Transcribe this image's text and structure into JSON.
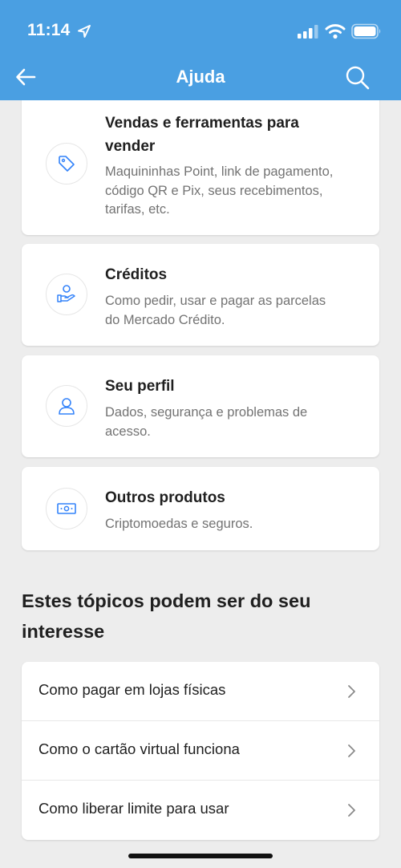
{
  "status_bar": {
    "time": "11:14"
  },
  "header": {
    "title": "Ajuda",
    "color": "#4a9fe2"
  },
  "cards": [
    {
      "title_line1": "Vendas e ferramentas para",
      "title_line2": "vender",
      "desc_line1": "Maquininhas Point, link de pagamento,",
      "desc_line2": "código QR e Pix, seus recebimentos,",
      "desc_line3": "tarifas, etc.",
      "icon": "tag-icon"
    },
    {
      "title": "Créditos",
      "desc_line1": "Como pedir, usar e pagar as parcelas",
      "desc_line2": "do Mercado Crédito.",
      "icon": "hand-coin-icon"
    },
    {
      "title": "Seu perfil",
      "desc_line1": "Dados, segurança e problemas de",
      "desc_line2": "acesso.",
      "icon": "user-icon"
    },
    {
      "title": "Outros produtos",
      "desc_line1": "Criptomoedas e seguros.",
      "icon": "banknote-icon"
    }
  ],
  "topics": {
    "heading_line1": "Estes tópicos podem ser do seu",
    "heading_line2": "interesse",
    "items": [
      {
        "label": "Como pagar em lojas físicas"
      },
      {
        "label": "Como o cartão virtual funciona"
      },
      {
        "label": "Como liberar limite para usar"
      }
    ]
  },
  "colors": {
    "accent": "#4a9fe2",
    "icon_blue": "#3483fa",
    "background": "#ededed"
  }
}
